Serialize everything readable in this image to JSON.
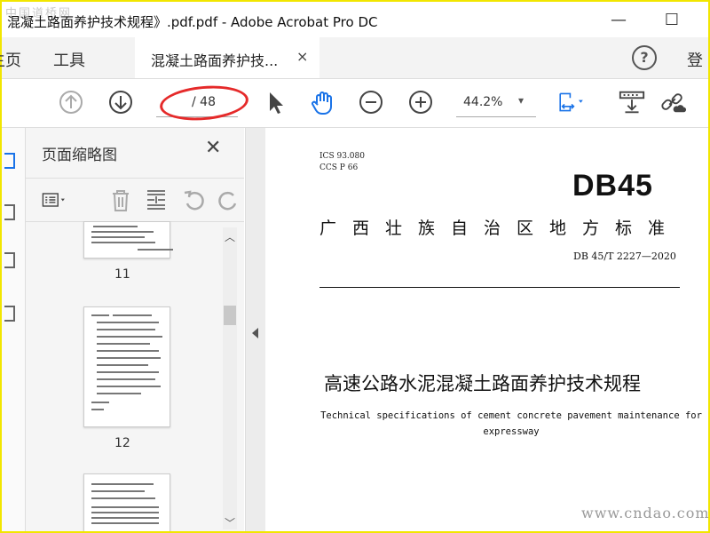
{
  "watermark_top": "中国道桥网",
  "window": {
    "title": "混凝土路面养护技术规程》.pdf.pdf - Adobe Acrobat Pro DC",
    "minimize": "—",
    "maximize": "☐"
  },
  "tabs": {
    "home": "主页",
    "tools": "工具",
    "document_tab": "混凝土路面养护技...",
    "close": "×",
    "help": "?",
    "login": "登"
  },
  "toolbar": {
    "page_input_value": "",
    "page_total": "/ 48",
    "zoom_value": "44.2%",
    "zoom_caret": "▾",
    "accent_color": "#1a73e8",
    "annotation_color": "#e52a2a"
  },
  "thumbnails_panel": {
    "title": "页面缩略图",
    "close": "✕",
    "pages": [
      {
        "number": "11"
      },
      {
        "number": "12"
      }
    ]
  },
  "document": {
    "ics": "ICS  93.080",
    "ccs": "CCS  P  66",
    "code": "DB45",
    "region": "广西壮族自治区地方标准",
    "standard_number": "DB 45/T  2227—2020",
    "title_cn": "高速公路水泥混凝土路面养护技术规程",
    "title_en_line1": "Technical specifications of cement concrete pavement maintenance for",
    "title_en_line2": "expressway"
  },
  "watermark_bottom": "www.cndao.com"
}
